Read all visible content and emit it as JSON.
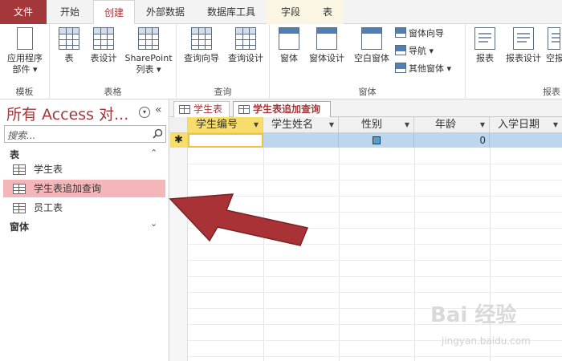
{
  "ribbon_tabs": [
    "文件",
    "开始",
    "创建",
    "外部数据",
    "数据库工具",
    "字段",
    "表"
  ],
  "ribbon": {
    "groups": {
      "templates": "模板",
      "tables": "表格",
      "queries": "查询",
      "forms": "窗体",
      "reports": "报表"
    },
    "buttons": {
      "app_parts_1": "应用程序",
      "app_parts_2": "部件 ▾",
      "table": "表",
      "table_design": "表设计",
      "sharepoint_1": "SharePoint",
      "sharepoint_2": "列表 ▾",
      "query_wizard": "查询向导",
      "query_design": "查询设计",
      "form": "窗体",
      "form_design": "窗体设计",
      "blank_form": "空白窗体",
      "form_wizard": "窗体向导",
      "navigation": "导航 ▾",
      "more_forms": "其他窗体 ▾",
      "report": "报表",
      "report_design": "报表设计",
      "blank_report": "空报"
    }
  },
  "nav": {
    "title": "所有 Access 对...",
    "search_placeholder": "搜索...",
    "categories": [
      {
        "label": "表",
        "chevron": "⌃"
      },
      {
        "label": "窗体",
        "chevron": "⌄"
      }
    ],
    "items": [
      "学生表",
      "学生表追加查询",
      "员工表"
    ],
    "selected": "学生表追加查询"
  },
  "doc_tabs": [
    "学生表",
    "学生表追加查询"
  ],
  "datasheet": {
    "columns": [
      "学生编号",
      "学生姓名",
      "性别",
      "年龄",
      "入学日期"
    ],
    "new_row_marker": "✱",
    "new_row_age": "0"
  },
  "watermark": {
    "brand": "Bai 经验",
    "url": "jingyan.baidu.com"
  },
  "colors": {
    "accent": "#a4373a",
    "selected_item": "#f4b6b8",
    "new_row": "#bcd6ee",
    "arrow": "#a83236"
  }
}
